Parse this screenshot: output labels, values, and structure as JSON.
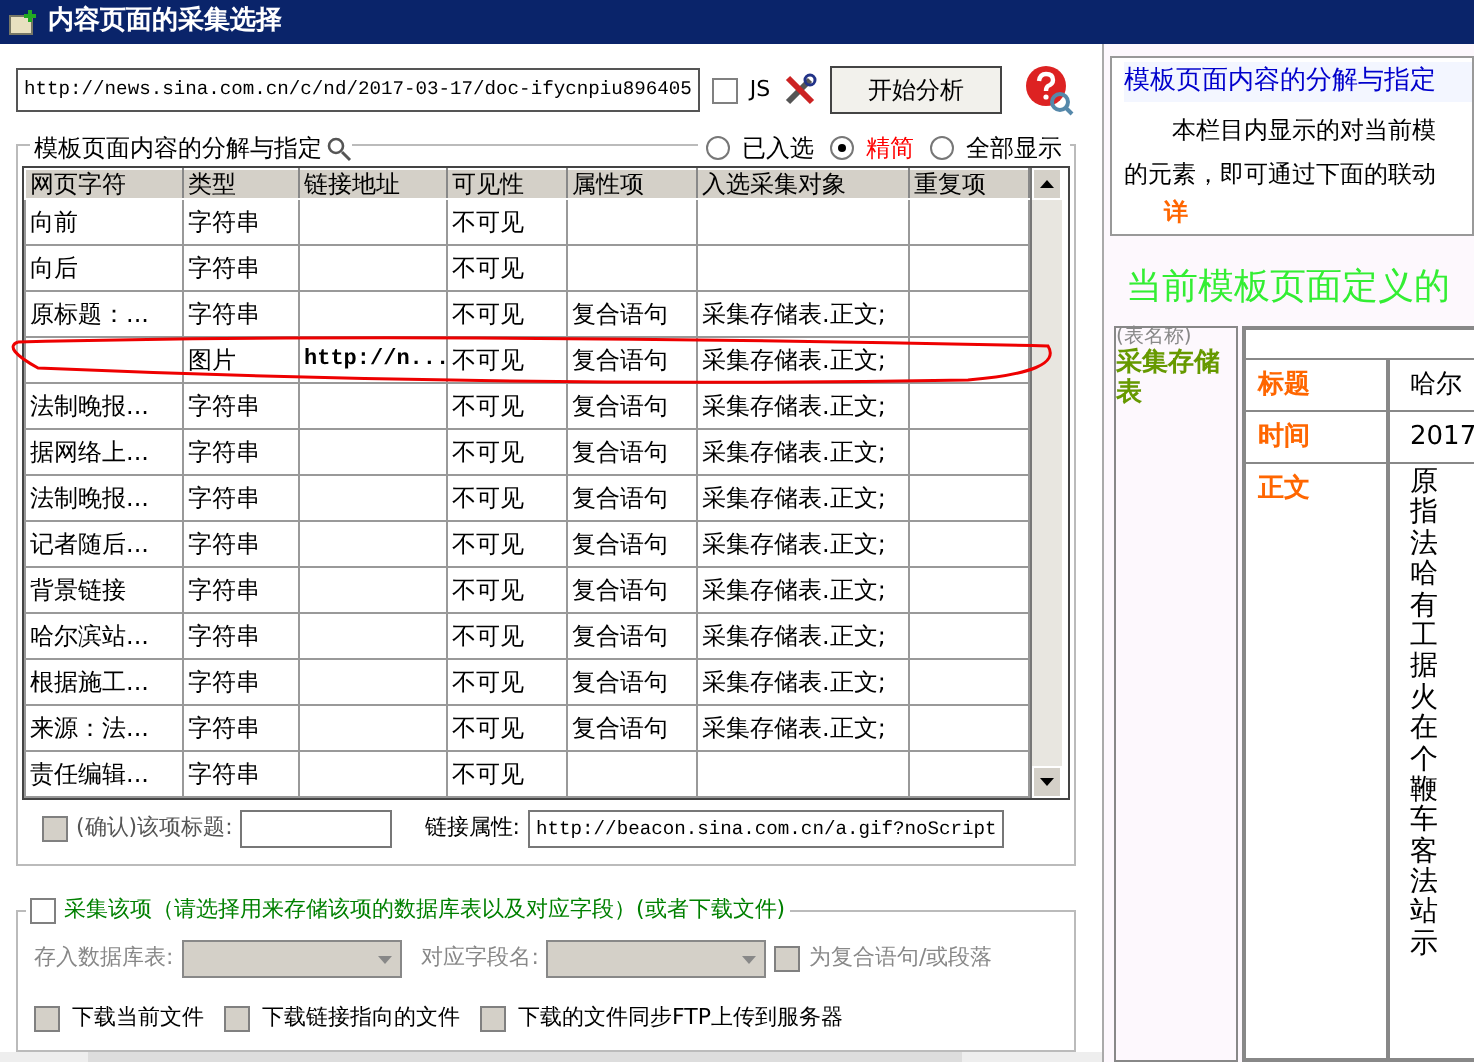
{
  "window": {
    "title": "内容页面的采集选择"
  },
  "url_bar": {
    "value": "http://news.sina.com.cn/c/nd/2017-03-17/doc-ifycnpiu896405",
    "js": {
      "label": "JS",
      "checked": false
    },
    "analyze_button": "开始分析"
  },
  "decomposition": {
    "legend": "模板页面内容的分解与指定",
    "filters": [
      {
        "label": "已入选",
        "selected": false
      },
      {
        "label": "精简",
        "selected": true
      },
      {
        "label": "全部显示",
        "selected": false
      }
    ],
    "columns": [
      "网页字符",
      "类型",
      "链接地址",
      "可见性",
      "属性项",
      "入选采集对象",
      "重复项"
    ],
    "rows": [
      {
        "cells": [
          "向前",
          "字符串",
          "",
          "不可见",
          "",
          "",
          ""
        ],
        "circled": false
      },
      {
        "cells": [
          "向后",
          "字符串",
          "",
          "不可见",
          "",
          "",
          ""
        ],
        "circled": false
      },
      {
        "cells": [
          "原标题：...",
          "字符串",
          "",
          "不可见",
          "复合语句",
          "采集存储表.正文;",
          ""
        ],
        "circled": false
      },
      {
        "cells": [
          "",
          "图片",
          "http://n...",
          "不可见",
          "复合语句",
          "采集存储表.正文;",
          ""
        ],
        "circled": true
      },
      {
        "cells": [
          "法制晚报...",
          "字符串",
          "",
          "不可见",
          "复合语句",
          "采集存储表.正文;",
          ""
        ],
        "circled": false
      },
      {
        "cells": [
          "据网络上...",
          "字符串",
          "",
          "不可见",
          "复合语句",
          "采集存储表.正文;",
          ""
        ],
        "circled": false
      },
      {
        "cells": [
          "法制晚报...",
          "字符串",
          "",
          "不可见",
          "复合语句",
          "采集存储表.正文;",
          ""
        ],
        "circled": false
      },
      {
        "cells": [
          "记者随后...",
          "字符串",
          "",
          "不可见",
          "复合语句",
          "采集存储表.正文;",
          ""
        ],
        "circled": false
      },
      {
        "cells": [
          "背景链接",
          "字符串",
          "",
          "不可见",
          "复合语句",
          "采集存储表.正文;",
          ""
        ],
        "circled": false
      },
      {
        "cells": [
          "哈尔滨站...",
          "字符串",
          "",
          "不可见",
          "复合语句",
          "采集存储表.正文;",
          ""
        ],
        "circled": false
      },
      {
        "cells": [
          "根据施工...",
          "字符串",
          "",
          "不可见",
          "复合语句",
          "采集存储表.正文;",
          ""
        ],
        "circled": false
      },
      {
        "cells": [
          "来源：法...",
          "字符串",
          "",
          "不可见",
          "复合语句",
          "采集存储表.正文;",
          ""
        ],
        "circled": false
      },
      {
        "cells": [
          "责任编辑...",
          "字符串",
          "",
          "不可见",
          "",
          "",
          ""
        ],
        "circled": false
      }
    ]
  },
  "confirm": {
    "checked": false,
    "label": "(确认)该项标题:",
    "link_label": "链接属性:",
    "link_value": "http://beacon.sina.com.cn/a.gif?noScript"
  },
  "collect": {
    "checked": false,
    "label": "采集该项（请选择用来存储该项的数据库表以及对应字段）(或者下载文件)",
    "table_label": "存入数据库表:",
    "field_label": "对应字段名:",
    "disabled": true,
    "compound": {
      "label": "为复合语句/或段落",
      "checked": false
    },
    "downloads": [
      {
        "label": "下载当前文件",
        "checked": false
      },
      {
        "label": "下载链接指向的文件",
        "checked": false
      },
      {
        "label": "下载的文件同步FTP上传到服务器",
        "checked": false
      }
    ]
  },
  "help": {
    "title": "模板页面内容的分解与指定",
    "lines": [
      "本栏目内显示的对当前模",
      "的元素，即可通过下面的联动"
    ],
    "more": "详"
  },
  "definition": {
    "heading": "当前模板页面定义的",
    "table_hint": "(表名称)",
    "table_name": "采集存储表",
    "fields": [
      {
        "name": "标题",
        "value": "哈尔",
        "kind": "line"
      },
      {
        "name": "时间",
        "value": "2017",
        "kind": "line"
      },
      {
        "name": "正文",
        "value": "原指法哈有工据火在个鞭车客法站示",
        "kind": "column"
      }
    ]
  }
}
